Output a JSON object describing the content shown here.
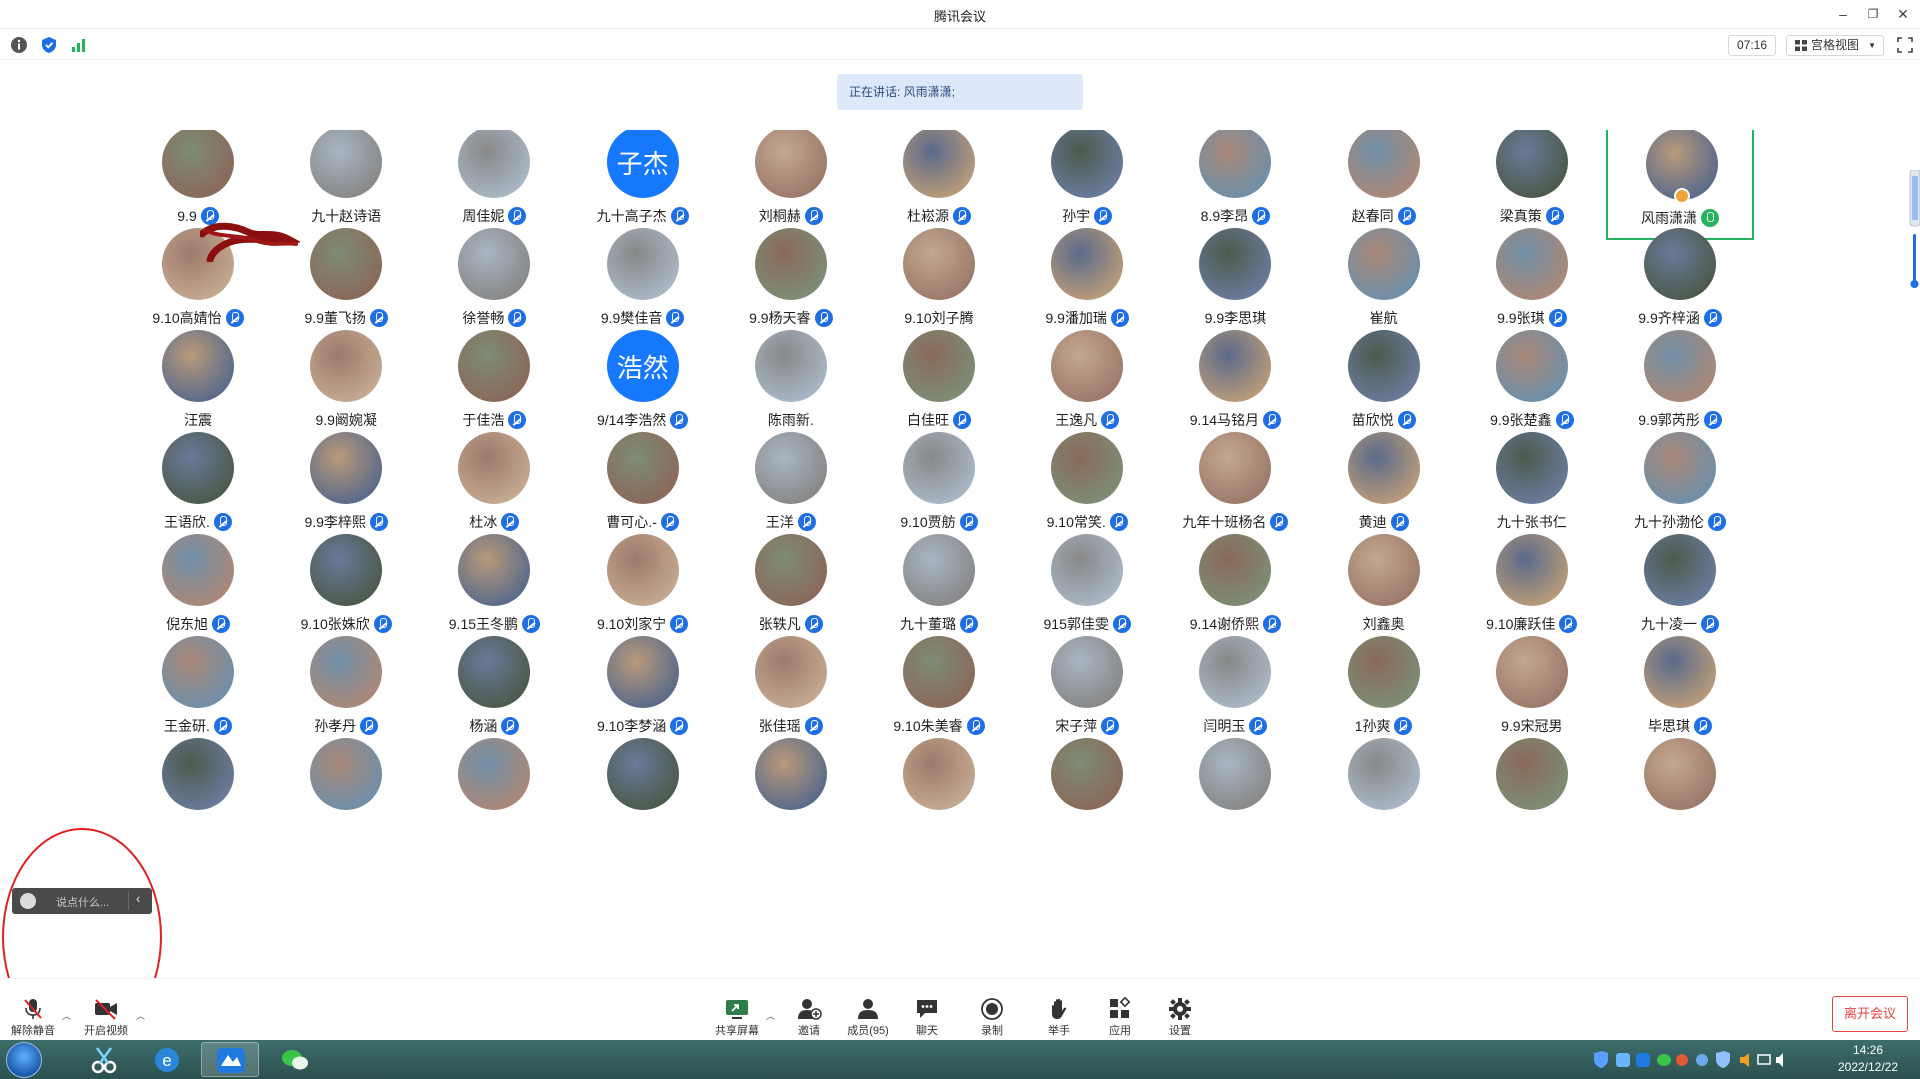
{
  "window": {
    "title": "腾讯会议"
  },
  "toolbar": {
    "timer": "07:16",
    "view_label": "宫格视图"
  },
  "speaking": {
    "text": "正在讲话: 风雨潇潇;"
  },
  "participants": [
    {
      "name": "9.9",
      "avatar": "photo",
      "mic": "muted"
    },
    {
      "name": "九十赵诗语",
      "avatar": "photo",
      "mic": "none"
    },
    {
      "name": "周佳妮",
      "avatar": "photo",
      "mic": "muted"
    },
    {
      "name": "九十高子杰",
      "avatar": "text",
      "avatar_text": "子杰",
      "mic": "muted"
    },
    {
      "name": "刘桐赫",
      "avatar": "photo",
      "mic": "muted"
    },
    {
      "name": "杜崧源",
      "avatar": "photo",
      "mic": "muted"
    },
    {
      "name": "孙宇",
      "avatar": "photo",
      "mic": "muted"
    },
    {
      "name": "8.9李昂",
      "avatar": "photo",
      "mic": "muted"
    },
    {
      "name": "赵春同",
      "avatar": "photo",
      "mic": "muted"
    },
    {
      "name": "梁真策",
      "avatar": "photo",
      "mic": "muted"
    },
    {
      "name": "风雨潇潇",
      "avatar": "photo",
      "mic": "speaking",
      "active": true,
      "host": true
    },
    {
      "name": "9.10高婧怡",
      "avatar": "photo",
      "mic": "muted"
    },
    {
      "name": "9.9董飞扬",
      "avatar": "photo",
      "mic": "muted"
    },
    {
      "name": "徐誉畅",
      "avatar": "photo",
      "mic": "muted"
    },
    {
      "name": "9.9樊佳音",
      "avatar": "photo",
      "mic": "muted"
    },
    {
      "name": "9.9杨天睿",
      "avatar": "photo",
      "mic": "muted"
    },
    {
      "name": "9.10刘子腾",
      "avatar": "photo",
      "mic": "none"
    },
    {
      "name": "9.9潘加瑞",
      "avatar": "photo",
      "mic": "muted"
    },
    {
      "name": "9.9李思琪",
      "avatar": "photo",
      "mic": "none"
    },
    {
      "name": "崔航",
      "avatar": "photo",
      "mic": "none"
    },
    {
      "name": "9.9张琪",
      "avatar": "photo",
      "mic": "muted"
    },
    {
      "name": "9.9齐梓涵",
      "avatar": "photo",
      "mic": "muted"
    },
    {
      "name": "汪震",
      "avatar": "photo",
      "mic": "none"
    },
    {
      "name": "9.9阚婉凝",
      "avatar": "photo",
      "mic": "none"
    },
    {
      "name": "于佳浩",
      "avatar": "photo",
      "mic": "muted"
    },
    {
      "name": "9/14李浩然",
      "avatar": "text",
      "avatar_text": "浩然",
      "mic": "muted"
    },
    {
      "name": "陈雨新.",
      "avatar": "photo",
      "mic": "none"
    },
    {
      "name": "白佳旺",
      "avatar": "photo",
      "mic": "muted"
    },
    {
      "name": "王逸凡",
      "avatar": "photo",
      "mic": "muted"
    },
    {
      "name": "9.14马铭月",
      "avatar": "photo",
      "mic": "muted"
    },
    {
      "name": "苗欣悦",
      "avatar": "photo",
      "mic": "muted"
    },
    {
      "name": "9.9张楚鑫",
      "avatar": "photo",
      "mic": "muted"
    },
    {
      "name": "9.9郭芮彤",
      "avatar": "photo",
      "mic": "muted"
    },
    {
      "name": "王语欣.",
      "avatar": "photo",
      "mic": "muted"
    },
    {
      "name": "9.9李梓熙",
      "avatar": "photo",
      "mic": "muted"
    },
    {
      "name": "杜冰",
      "avatar": "photo",
      "mic": "muted"
    },
    {
      "name": "曹可心.-",
      "avatar": "photo",
      "mic": "muted"
    },
    {
      "name": "王洋",
      "avatar": "photo",
      "mic": "muted"
    },
    {
      "name": "9.10贾舫",
      "avatar": "photo",
      "mic": "muted"
    },
    {
      "name": "9.10常笑.",
      "avatar": "photo",
      "mic": "muted"
    },
    {
      "name": "九年十班杨名",
      "avatar": "photo",
      "mic": "muted"
    },
    {
      "name": "黄迪",
      "avatar": "photo",
      "mic": "muted"
    },
    {
      "name": "九十张书仁",
      "avatar": "photo",
      "mic": "none"
    },
    {
      "name": "九十孙渤伦",
      "avatar": "photo",
      "mic": "muted"
    },
    {
      "name": "倪东旭",
      "avatar": "photo",
      "mic": "muted"
    },
    {
      "name": "9.10张姝欣",
      "avatar": "photo",
      "mic": "muted"
    },
    {
      "name": "9.15王冬鹏",
      "avatar": "photo",
      "mic": "muted"
    },
    {
      "name": "9.10刘家宁",
      "avatar": "photo",
      "mic": "muted"
    },
    {
      "name": "张轶凡",
      "avatar": "photo",
      "mic": "muted"
    },
    {
      "name": "九十董璐",
      "avatar": "photo",
      "mic": "muted"
    },
    {
      "name": "915郭佳雯",
      "avatar": "photo",
      "mic": "muted"
    },
    {
      "name": "9.14谢侨熙",
      "avatar": "photo",
      "mic": "muted"
    },
    {
      "name": "刘鑫奥",
      "avatar": "photo",
      "mic": "none"
    },
    {
      "name": "9.10廉跃佳",
      "avatar": "photo",
      "mic": "muted"
    },
    {
      "name": "九十凌一",
      "avatar": "photo",
      "mic": "muted"
    },
    {
      "name": "王金研.",
      "avatar": "photo",
      "mic": "muted"
    },
    {
      "name": "孙孝丹",
      "avatar": "photo",
      "mic": "muted"
    },
    {
      "name": "杨涵",
      "avatar": "photo",
      "mic": "muted"
    },
    {
      "name": "9.10李梦涵",
      "avatar": "photo",
      "mic": "muted"
    },
    {
      "name": "张佳瑶",
      "avatar": "photo",
      "mic": "muted"
    },
    {
      "name": "9.10朱美睿",
      "avatar": "photo",
      "mic": "muted"
    },
    {
      "name": "宋子萍",
      "avatar": "photo",
      "mic": "muted"
    },
    {
      "name": "闫明玉",
      "avatar": "photo",
      "mic": "muted"
    },
    {
      "name": "1孙爽",
      "avatar": "photo",
      "mic": "muted"
    },
    {
      "name": "9.9宋冠男",
      "avatar": "photo",
      "mic": "none"
    },
    {
      "name": "毕思琪",
      "avatar": "photo",
      "mic": "muted"
    },
    {
      "name": "",
      "avatar": "photo",
      "mic": "none"
    },
    {
      "name": "",
      "avatar": "photo",
      "mic": "none"
    },
    {
      "name": "",
      "avatar": "photo",
      "mic": "none"
    },
    {
      "name": "",
      "avatar": "photo",
      "mic": "none"
    },
    {
      "name": "",
      "avatar": "photo",
      "mic": "none"
    },
    {
      "name": "",
      "avatar": "photo",
      "mic": "none"
    },
    {
      "name": "",
      "avatar": "photo",
      "mic": "none"
    },
    {
      "name": "",
      "avatar": "photo",
      "mic": "none"
    },
    {
      "name": "",
      "avatar": "photo",
      "mic": "none"
    },
    {
      "name": "",
      "avatar": "photo",
      "mic": "none"
    },
    {
      "name": "",
      "avatar": "photo",
      "mic": "none"
    }
  ],
  "chat": {
    "placeholder": "说点什么..."
  },
  "bottombar": {
    "unmute": "解除静音",
    "start_video": "开启视频",
    "share_screen": "共享屏幕",
    "invite": "邀请",
    "members": "成员(95)",
    "chat": "聊天",
    "record": "录制",
    "raise_hand": "举手",
    "apps": "应用",
    "settings": "设置",
    "leave": "离开会议"
  },
  "taskbar": {
    "time": "14:26",
    "date": "2022/12/22"
  },
  "colors": {
    "accent": "#1e6fe6",
    "speaking": "#23b55d",
    "leave": "#e64545",
    "taskbar": "#2f5958"
  }
}
